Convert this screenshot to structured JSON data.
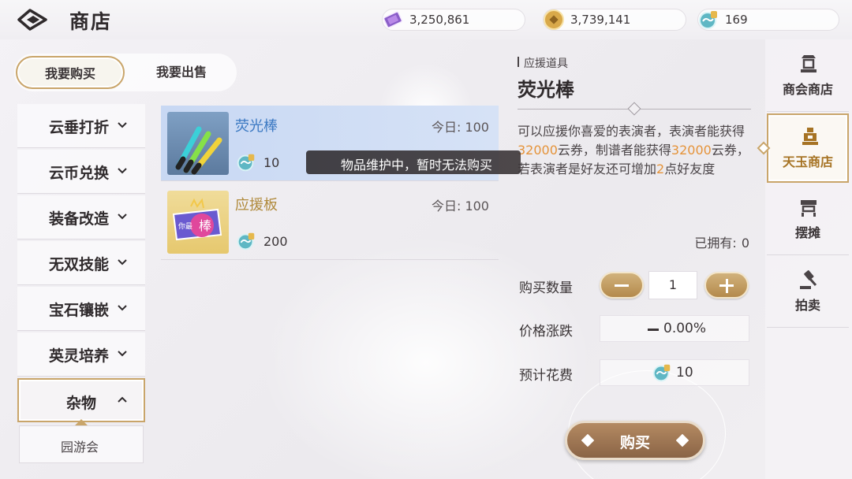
{
  "header": {
    "title": "商店",
    "currencies": [
      {
        "icon": "purple-ticket-icon",
        "value": "3,250,861"
      },
      {
        "icon": "gold-coin-icon",
        "value": "3,739,141"
      },
      {
        "icon": "cloud-token-icon",
        "value": "169"
      }
    ]
  },
  "trade_toggle": {
    "buy": "我要购买",
    "sell": "我要出售",
    "selected": "我要购买"
  },
  "categories": [
    {
      "label": "云垂打折",
      "expanded": false
    },
    {
      "label": "云币兑换",
      "expanded": false
    },
    {
      "label": "装备改造",
      "expanded": false
    },
    {
      "label": "无双技能",
      "expanded": false
    },
    {
      "label": "宝石镶嵌",
      "expanded": false
    },
    {
      "label": "英灵培养",
      "expanded": false
    },
    {
      "label": "杂物",
      "expanded": true
    }
  ],
  "subcategories": [
    "园游会"
  ],
  "items": [
    {
      "name": "荧光棒",
      "today": "今日: 100",
      "price": "10",
      "selected": true
    },
    {
      "name": "应援板",
      "today": "今日: 100",
      "price": "200",
      "selected": false
    }
  ],
  "tooltip": "物品维护中，暂时无法购买",
  "detail": {
    "category": "应援道具",
    "name": "荧光棒",
    "desc": {
      "p1": "可以应援你喜爱的表演者，表演者能获得",
      "n1": "32000",
      "p2": "云券，制谱者能获得",
      "n2": "32000",
      "p3": "云券，若表演者是好友还可增加",
      "n3": "2",
      "p4": "点好友度"
    },
    "owned_label": "已拥有:",
    "owned_value": "0",
    "qty_label": "购买数量",
    "qty_value": "1",
    "price_change_label": "价格涨跌",
    "price_change_value": "0.00%",
    "cost_label": "预计花费",
    "cost_value": "10",
    "buy_label": "购买"
  },
  "right_tabs": [
    {
      "label": "商会商店",
      "icon": "guild-shop-icon",
      "active": false
    },
    {
      "label": "天玉商店",
      "icon": "jade-shop-icon",
      "active": true
    },
    {
      "label": "摆摊",
      "icon": "stall-icon",
      "active": false
    },
    {
      "label": "拍卖",
      "icon": "auction-gavel-icon",
      "active": false
    }
  ],
  "colors": {
    "accent_gold": "#c9a56a",
    "highlight_orange": "#e5933a",
    "selected_blue": "#3a78c2"
  }
}
